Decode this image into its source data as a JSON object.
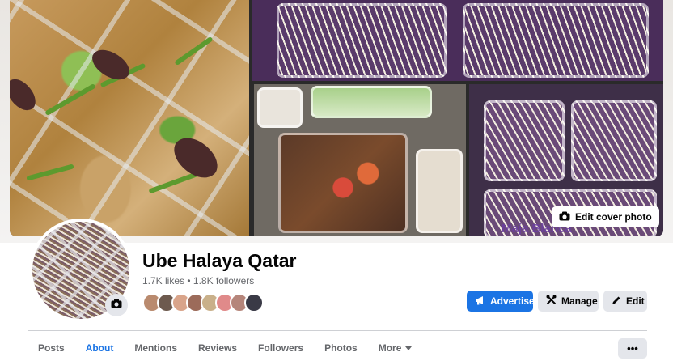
{
  "cover": {
    "edit_label": "Edit cover photo",
    "watermark": "Maja Blanca"
  },
  "profile": {
    "name": "Ube Halaya Qatar",
    "stats": "1.7K likes • 1.8K followers",
    "friend_count_shown": 8
  },
  "actions": {
    "advertise": "Advertise",
    "manage": "Manage",
    "edit": "Edit"
  },
  "tabs": [
    {
      "label": "Posts"
    },
    {
      "label": "About"
    },
    {
      "label": "Mentions"
    },
    {
      "label": "Reviews"
    },
    {
      "label": "Followers"
    },
    {
      "label": "Photos"
    },
    {
      "label": "More"
    }
  ],
  "more_menu": {
    "label": "•••"
  },
  "icons": {
    "camera": "camera-icon",
    "megaphone": "megaphone-icon",
    "tools": "tools-icon",
    "pencil": "pencil-icon",
    "caret": "caret-down-icon"
  },
  "colors": {
    "accent": "#1b74e4",
    "button_gray": "#e4e6eb",
    "text_secondary": "#65676b",
    "watermark": "#6b3fa0"
  }
}
